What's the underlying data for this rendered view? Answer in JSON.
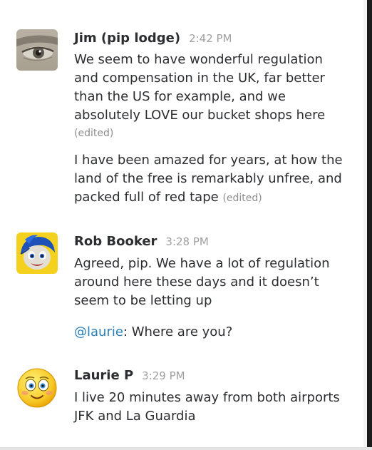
{
  "messages": [
    {
      "author": "Jim (pip lodge)",
      "time": "2:42 PM",
      "avatar": "eye-photo-avatar",
      "paragraphs": [
        {
          "lines": [
            "We seem to have wonderful regulation",
            "and compensation in the UK, far better",
            "than the US for example, and we",
            "absolutely LOVE our bucket shops here"
          ],
          "edited": "(edited)"
        },
        {
          "lines": [
            "I have been amazed for years, at how the",
            "land of the free is remarkably unfree, and",
            "packed full of red tape"
          ],
          "edited": "(edited)"
        }
      ]
    },
    {
      "author": "Rob Booker",
      "time": "3:28 PM",
      "avatar": "cartoon-joy-avatar",
      "paragraphs": [
        {
          "lines": [
            "Agreed, pip. We have a lot of regulation",
            "around here these days and it doesn’t",
            "seem to be letting up"
          ]
        },
        {
          "mention": "@laurie",
          "text": ": Where are you?"
        }
      ]
    },
    {
      "author": "Laurie P",
      "time": "3:29 PM",
      "avatar": "smiley-emoji-avatar",
      "paragraphs": [
        {
          "lines": [
            "I live 20 minutes away from both airports",
            "JFK and La Guardia"
          ]
        }
      ]
    }
  ],
  "colors": {
    "text": "#2c2d30",
    "timestamp": "#a0a0a2",
    "mention": "#2a80b9"
  }
}
